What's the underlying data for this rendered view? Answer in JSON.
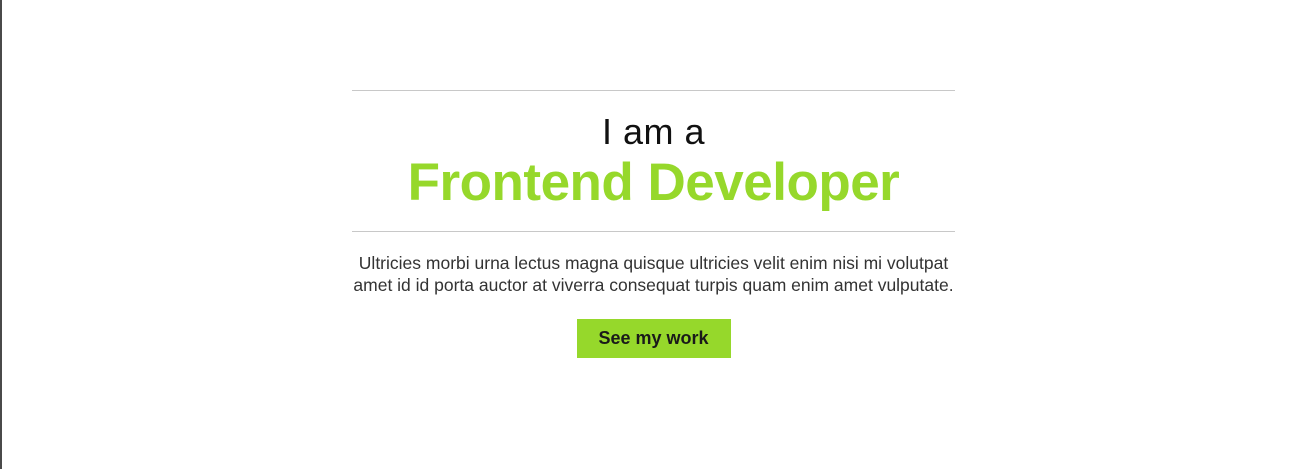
{
  "hero": {
    "intro": "I am a",
    "role": "Frontend Developer",
    "description": "Ultricies morbi urna lectus magna quisque ultricies velit enim nisi mi volutpat amet id id porta auctor at viverra consequat turpis quam enim amet vulputate.",
    "cta_label": "See my work"
  },
  "colors": {
    "accent": "#96d82b",
    "text": "#111111",
    "rule": "#c8c8c8",
    "background": "#ffffff"
  }
}
